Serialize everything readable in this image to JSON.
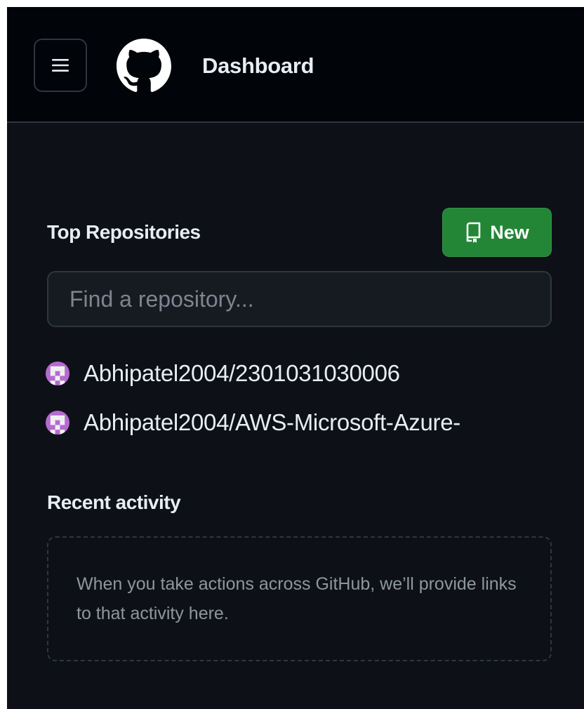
{
  "header": {
    "title": "Dashboard",
    "menu_icon": "hamburger-menu-icon",
    "logo_icon": "github-logo-icon"
  },
  "top_repositories": {
    "title": "Top Repositories",
    "new_button": {
      "label": "New",
      "icon": "repo-icon"
    },
    "search": {
      "placeholder": "Find a repository...",
      "value": ""
    },
    "items": [
      {
        "name": "Abhipatel2004/2301031030006",
        "avatar": "user-avatar"
      },
      {
        "name": "Abhipatel2004/AWS-Microsoft-Azure-",
        "avatar": "user-avatar"
      }
    ]
  },
  "recent_activity": {
    "title": "Recent activity",
    "empty_message": "When you take actions across GitHub, we’ll provide links to that activity here."
  },
  "colors": {
    "background": "#0d1117",
    "header_background": "#010409",
    "border": "#30363d",
    "primary_button": "#238636",
    "text": "#e6edf3",
    "muted_text": "#8d96a0",
    "avatar_accent": "#b56ad1"
  }
}
